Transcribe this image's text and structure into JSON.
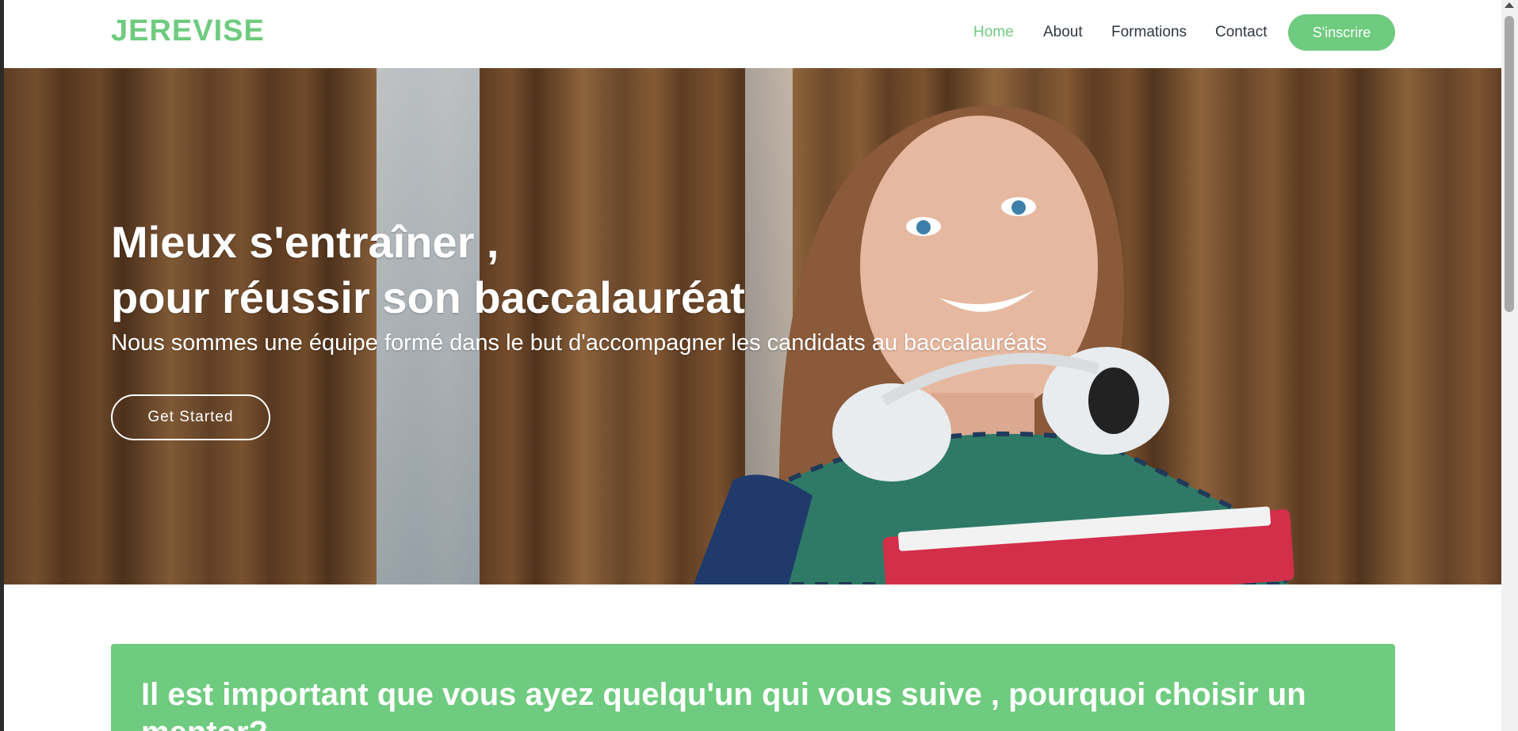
{
  "header": {
    "logo": "JEREVISE",
    "nav": [
      "Home",
      "About",
      "Formations",
      "Contact"
    ],
    "cta_label": "S'inscrire"
  },
  "hero": {
    "title_line1": "Mieux s'entraîner ,",
    "title_line2": "pour réussir son baccalauréat",
    "subtitle": "Nous sommes une équipe formé dans le but d'accompagner les candidats au baccalauréats",
    "button_label": "Get Started"
  },
  "why": {
    "title": "Il est important que vous ayez quelqu'un qui vous suive , pourquoi choisir un mentor?"
  },
  "colors": {
    "accent": "#6fcb7f",
    "nav_text": "#2f3640"
  }
}
